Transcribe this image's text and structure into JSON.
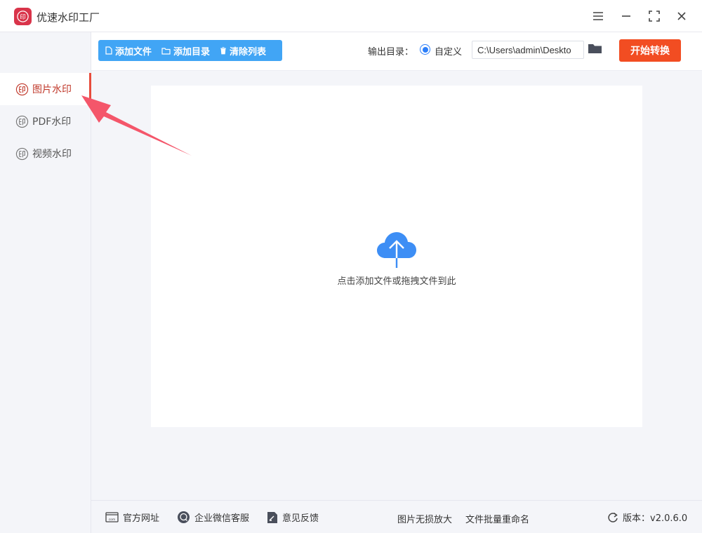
{
  "app": {
    "title": "优速水印工厂",
    "logo_glyph": "印"
  },
  "window_controls": [
    "menu-icon",
    "minimize-icon",
    "maximize-icon",
    "close-icon"
  ],
  "sidebar": {
    "items": [
      {
        "label": "图片水印",
        "icon": "stamp-icon",
        "active": true
      },
      {
        "label": "PDF水印",
        "icon": "stamp-icon",
        "active": false
      },
      {
        "label": "视频水印",
        "icon": "stamp-icon",
        "active": false
      }
    ]
  },
  "toolbar": {
    "add_file": "添加文件",
    "add_dir": "添加目录",
    "clear_list": "清除列表",
    "output_label": "输出目录：",
    "radio_label": "自定义",
    "output_path": "C:\\Users\\admin\\Deskto",
    "start": "开始转换"
  },
  "dropzone": {
    "text": "点击添加文件或拖拽文件到此"
  },
  "footer": {
    "website": "官方网址",
    "wechat": "企业微信客服",
    "feedback": "意见反馈",
    "upscale": "图片无损放大",
    "rename": "文件批量重命名",
    "version": "版本：v2.0.6.0"
  },
  "colors": {
    "accent_blue": "#41a5f5",
    "start_orange": "#f24d22",
    "active_red": "#c0392b",
    "arrow": "#f4566a"
  }
}
